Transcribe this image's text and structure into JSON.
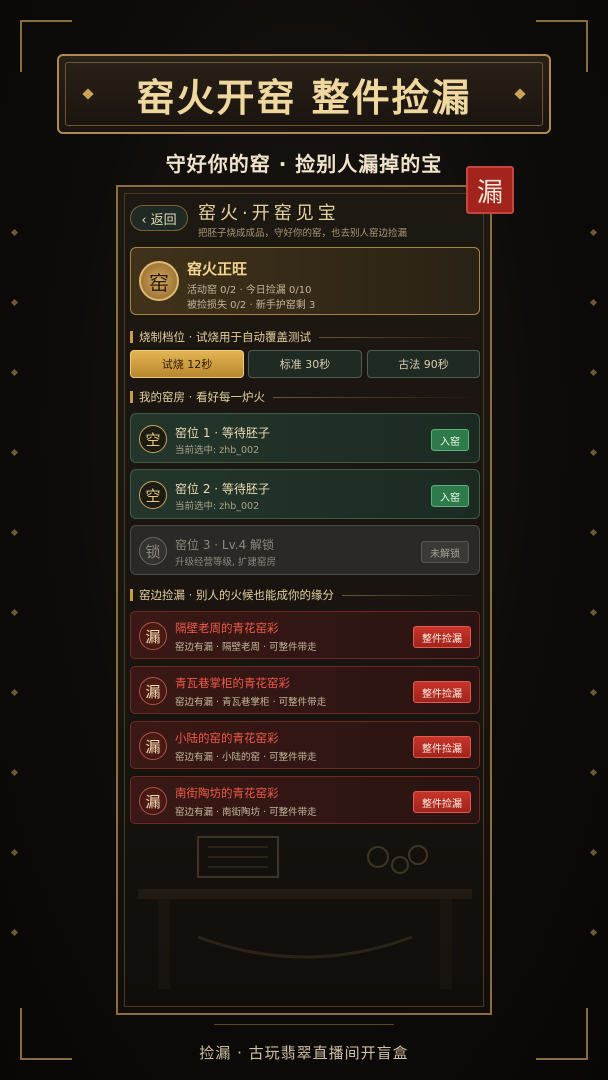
{
  "banner": {
    "title": "窑火开窑 整件捡漏"
  },
  "tagline": "守好你的窑 · 捡别人漏掉的宝",
  "seal_char": "漏",
  "panel": {
    "back_label": "‹ 返回",
    "title": "窑火·开窑见宝",
    "subtitle": "把胚子烧成成品，守好你的窑，也去别人窑边捡漏"
  },
  "status": {
    "icon_char": "窑",
    "title": "窑火正旺",
    "line1": "活动窑 0/2 · 今日捡漏 0/10",
    "line2": "被捡损失 0/2 · 新手护窑剩 3"
  },
  "sections": {
    "firing": "烧制档位 · 试烧用于自动覆盖测试",
    "kilns": "我的窑房 · 看好每一炉火",
    "leaks": "窑边捡漏 · 别人的火候也能成你的缘分"
  },
  "firing_options": [
    {
      "label": "试烧 12秒",
      "selected": true
    },
    {
      "label": "标准 30秒",
      "selected": false
    },
    {
      "label": "古法 90秒",
      "selected": false
    }
  ],
  "kilns": [
    {
      "icon": "空",
      "title": "窑位 1 · 等待胚子",
      "sub": "当前选中: zhb_002",
      "button": "入窑",
      "state": "empty"
    },
    {
      "icon": "空",
      "title": "窑位 2 · 等待胚子",
      "sub": "当前选中: zhb_002",
      "button": "入窑",
      "state": "empty"
    },
    {
      "icon": "锁",
      "title": "窑位 3 · Lv.4 解锁",
      "sub": "升级经营等级, 扩建窑房",
      "button": "未解锁",
      "state": "locked"
    }
  ],
  "leaks": [
    {
      "icon": "漏",
      "title": "隔壁老周的青花窑彩",
      "sub": "窑边有漏 · 隔壁老周 · 可整件带走",
      "button": "整件捡漏"
    },
    {
      "icon": "漏",
      "title": "青瓦巷掌柜的青花窑彩",
      "sub": "窑边有漏 · 青瓦巷掌柜 · 可整件带走",
      "button": "整件捡漏"
    },
    {
      "icon": "漏",
      "title": "小陆的窑的青花窑彩",
      "sub": "窑边有漏 · 小陆的窑 · 可整件带走",
      "button": "整件捡漏"
    },
    {
      "icon": "漏",
      "title": "南街陶坊的青花窑彩",
      "sub": "窑边有漏 · 南街陶坊 · 可整件带走",
      "button": "整件捡漏"
    }
  ],
  "footer": "捡漏 · 古玩翡翠直播间开盲盒",
  "colors": {
    "gold": "#c99a4a",
    "red_button": "#b82c23",
    "green_button": "#2f7a4b",
    "background": "#0d0b09"
  }
}
